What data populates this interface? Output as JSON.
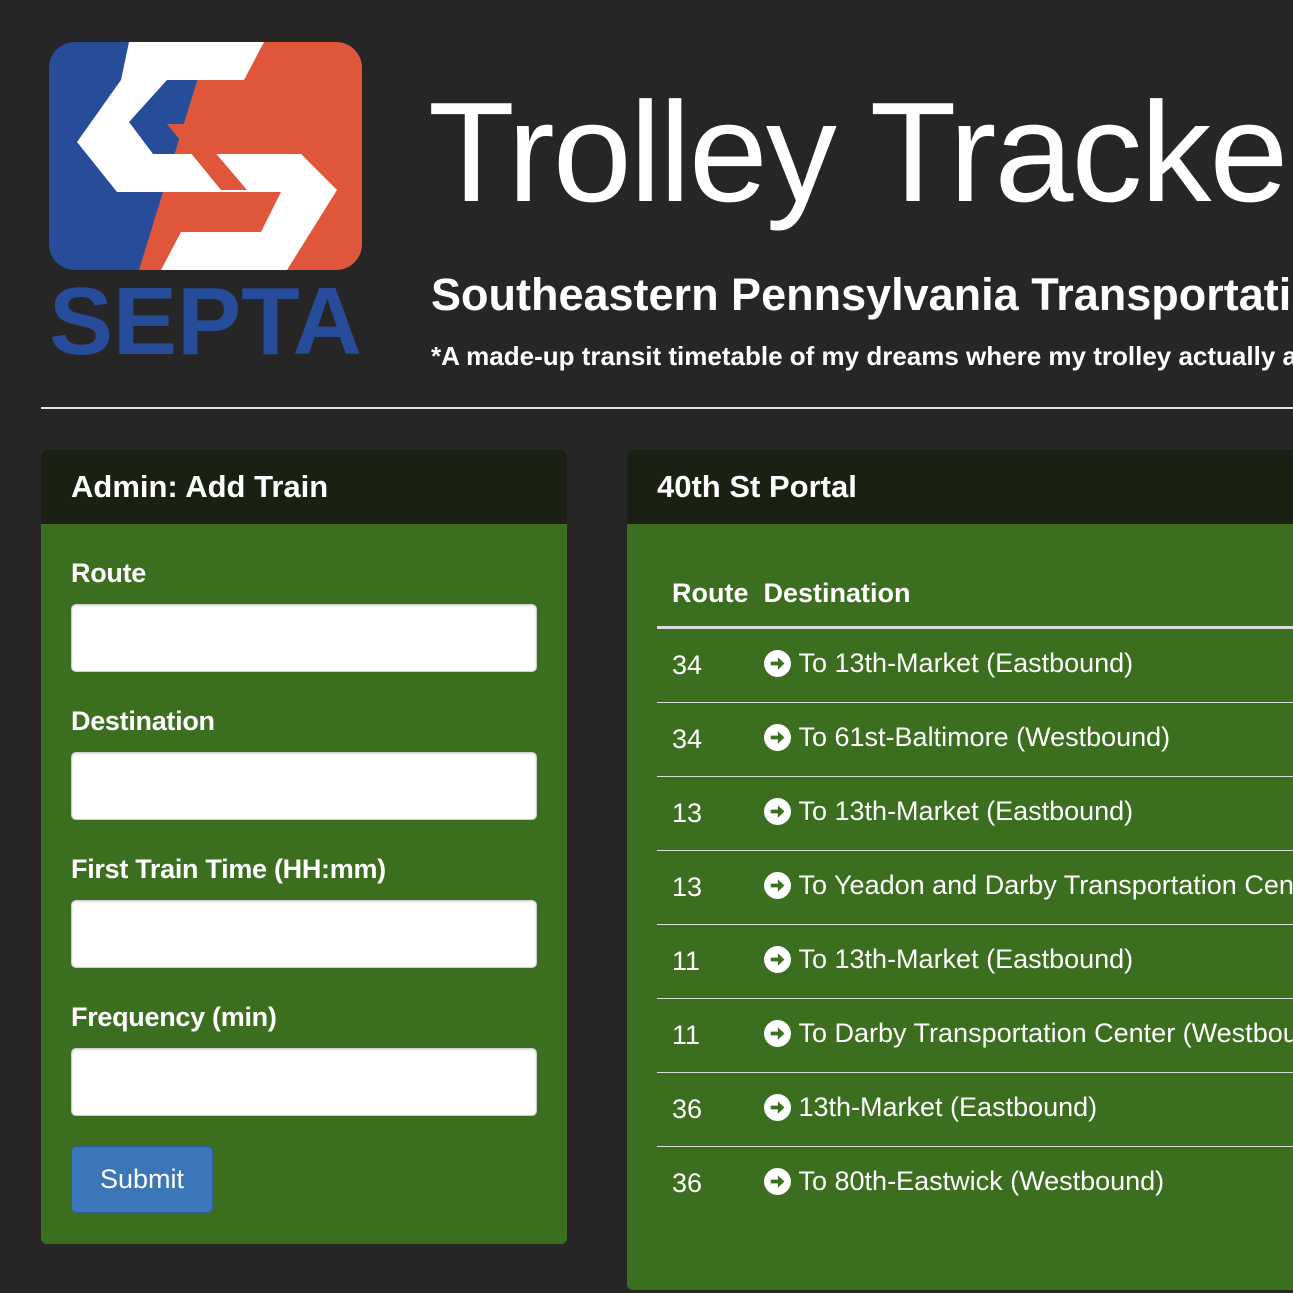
{
  "header": {
    "logo_text": "SEPTA",
    "title": "Trolley Tracker",
    "subtitle": "Southeastern Pennsylvania Transportation Authority",
    "tagline": "*A made-up transit timetable of my dreams where my trolley actually arrives on time"
  },
  "admin": {
    "heading": "Admin: Add Train",
    "fields": [
      {
        "label": "Route",
        "value": "",
        "placeholder": ""
      },
      {
        "label": "Destination",
        "value": "",
        "placeholder": ""
      },
      {
        "label": "First Train Time (HH:mm)",
        "value": "",
        "placeholder": ""
      },
      {
        "label": "Frequency (min)",
        "value": "",
        "placeholder": ""
      }
    ],
    "submit_label": "Submit"
  },
  "schedule": {
    "heading": "40th St Portal",
    "columns": [
      "Route",
      "Destination"
    ],
    "rows": [
      {
        "route": "34",
        "destination": "To 13th-Market (Eastbound)"
      },
      {
        "route": "34",
        "destination": "To 61st-Baltimore (Westbound)"
      },
      {
        "route": "13",
        "destination": "To 13th-Market (Eastbound)"
      },
      {
        "route": "13",
        "destination": "To Yeadon and Darby Transportation Center (Westbound)"
      },
      {
        "route": "11",
        "destination": "To 13th-Market (Eastbound)"
      },
      {
        "route": "11",
        "destination": "To Darby Transportation Center (Westbound)"
      },
      {
        "route": "36",
        "destination": "13th-Market (Eastbound)"
      },
      {
        "route": "36",
        "destination": "To 80th-Eastwick (Westbound)"
      }
    ],
    "row_icon": "circle-arrow-right-icon"
  },
  "colors": {
    "page_background": "#262626",
    "panel_body": "#3b6e1e",
    "panel_heading": "#1a2112",
    "septa_blue": "#274c9a",
    "septa_red": "#e0563a",
    "button_primary": "#3a76b8"
  }
}
